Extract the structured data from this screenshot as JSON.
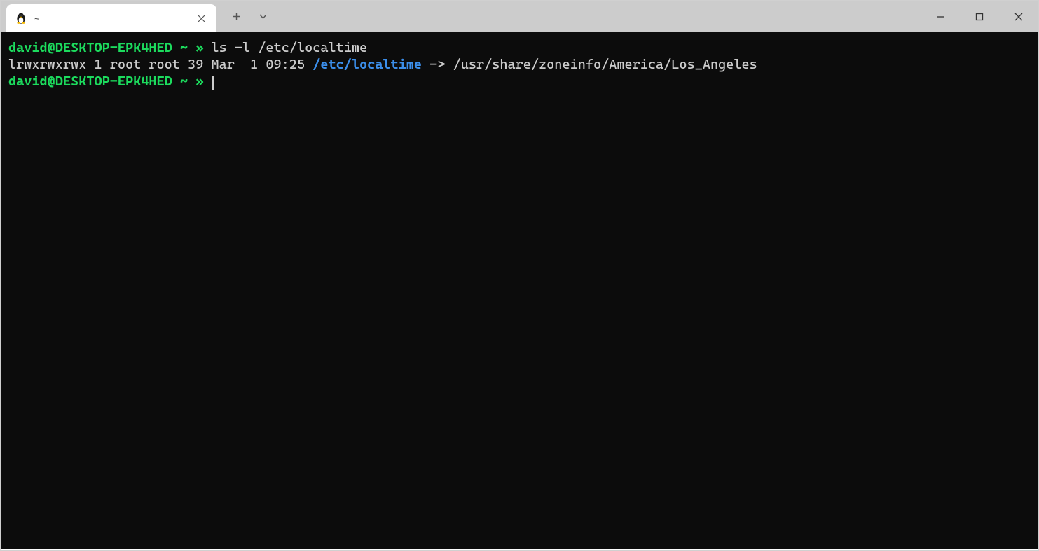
{
  "titlebar": {
    "tab": {
      "icon": "penguin-icon",
      "title": "~",
      "close_label": "×"
    },
    "new_tab": "+",
    "dropdown": "⌄"
  },
  "window_controls": {
    "minimize": "minimize",
    "maximize": "maximize",
    "close": "close"
  },
  "terminal": {
    "lines": [
      {
        "prompt_user": "david@DESKTOP-EPK4HED",
        "prompt_cwd": "~",
        "prompt_marker": "»",
        "command": "ls -l /etc/localtime"
      },
      {
        "output_prefix": "lrwxrwxrwx 1 root root 39 Mar  1 09:25 ",
        "symlink_path": "/etc/localtime",
        "output_suffix": " -> /usr/share/zoneinfo/America/Los_Angeles"
      },
      {
        "prompt_user": "david@DESKTOP-EPK4HED",
        "prompt_cwd": "~",
        "prompt_marker": "»",
        "cursor": true
      }
    ]
  }
}
